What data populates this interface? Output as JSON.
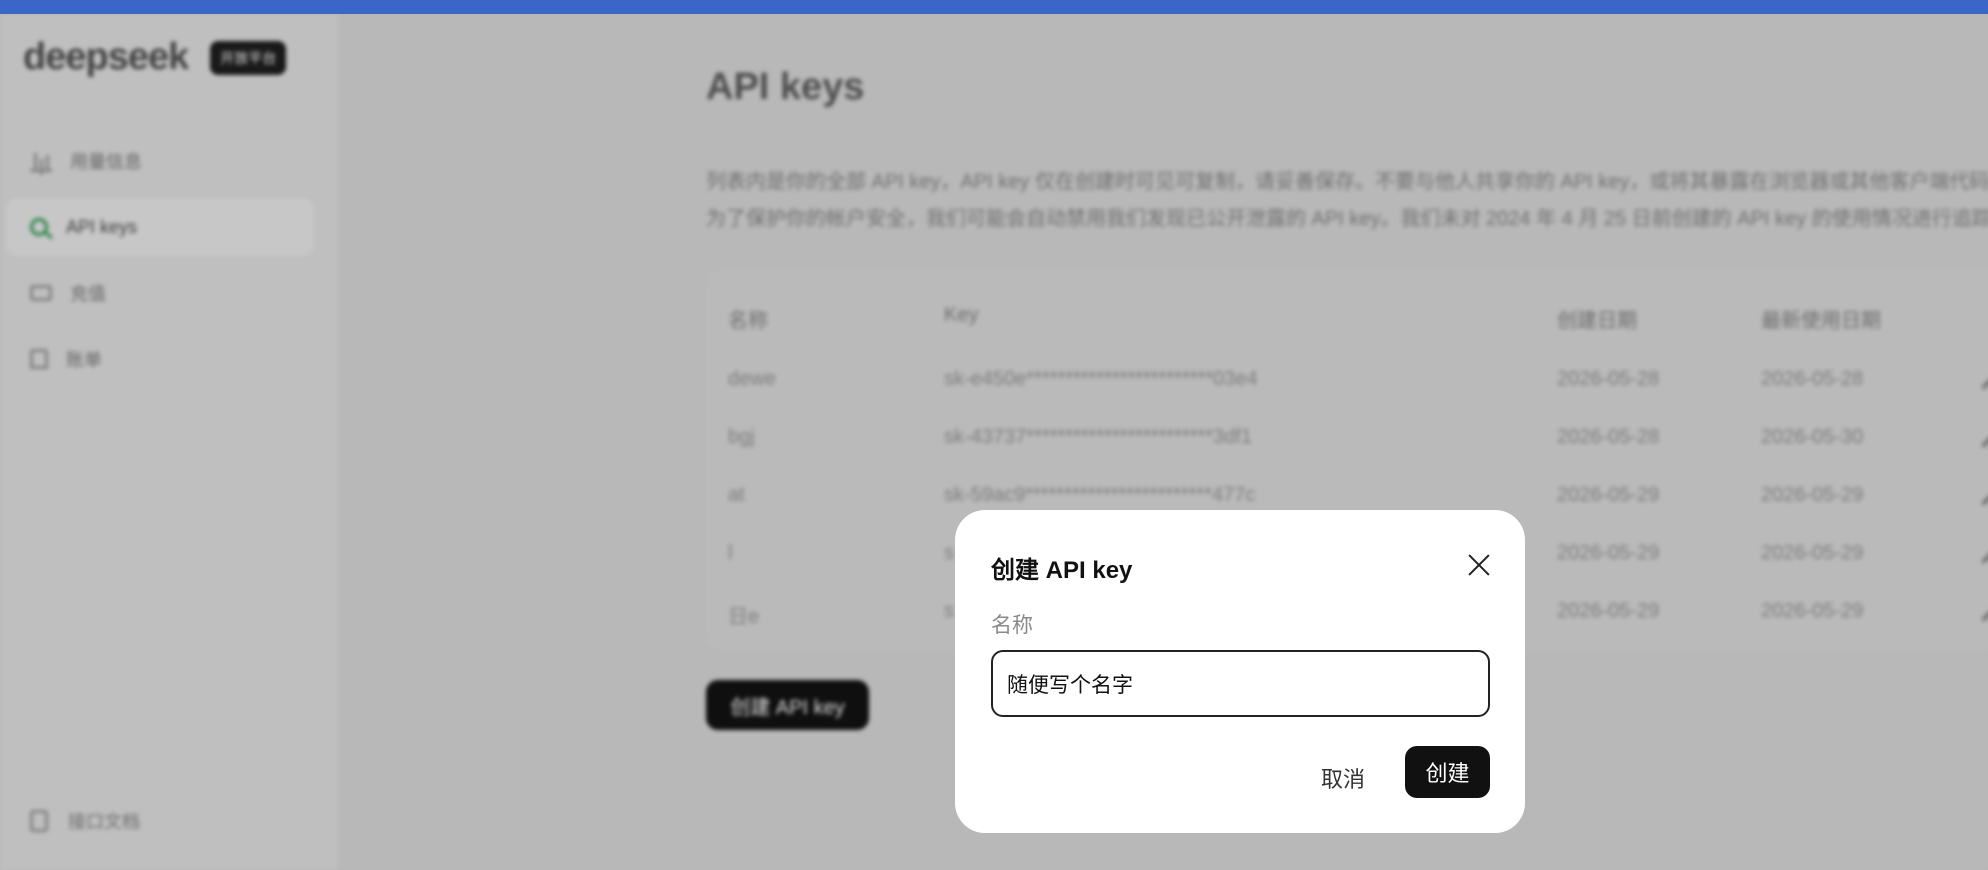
{
  "brand": {
    "logo": "deepseek",
    "badge": "开放平台"
  },
  "nav": {
    "items": [
      {
        "label": "用量信息",
        "icon": "bar-chart-icon"
      },
      {
        "label": "API keys",
        "icon": "search-icon"
      },
      {
        "label": "充值",
        "icon": "card-icon"
      },
      {
        "label": "账单",
        "icon": "bill-icon"
      }
    ],
    "bottom": {
      "label": "接口文档",
      "icon": "document-icon"
    }
  },
  "page": {
    "title": "API keys",
    "description": [
      "列表内是你的全部 API key，API key 仅在创建时可见可复制，请妥善保存。不要与他人共享你的 API key，或将其暴露在浏览器或其他客户端代码中。",
      "为了保护你的帐户安全，我们可能会自动禁用我们发现已公开泄露的 API key。我们未对 2024 年 4 月 25 日前创建的 API key 的使用情况进行追踪。"
    ]
  },
  "table": {
    "headers": [
      "名称",
      "Key",
      "创建日期",
      "最新使用日期"
    ],
    "rows": [
      {
        "name": "dewe",
        "key": "sk-e450e************************03e4",
        "created": "2026-05-28",
        "used": "2026-05-28"
      },
      {
        "name": "bgj",
        "key": "sk-43737************************3df1",
        "created": "2026-05-28",
        "used": "2026-05-30"
      },
      {
        "name": "at",
        "key": "sk-59ac9************************477c",
        "created": "2026-05-29",
        "used": "2026-05-29"
      },
      {
        "name": "l",
        "key": "s",
        "created": "2026-05-29",
        "used": "2026-05-29"
      },
      {
        "name": "日e",
        "key": "s",
        "created": "2026-05-29",
        "used": "2026-05-29"
      }
    ]
  },
  "create_button": "创建 API key",
  "modal": {
    "title": "创建 API key",
    "field_label": "名称",
    "input_value": "随便写个名字",
    "cancel": "取消",
    "submit": "创建"
  },
  "colors": {
    "top_strip": "#3a66c8",
    "primary": "#111111",
    "active_icon": "#2d8f4a"
  }
}
